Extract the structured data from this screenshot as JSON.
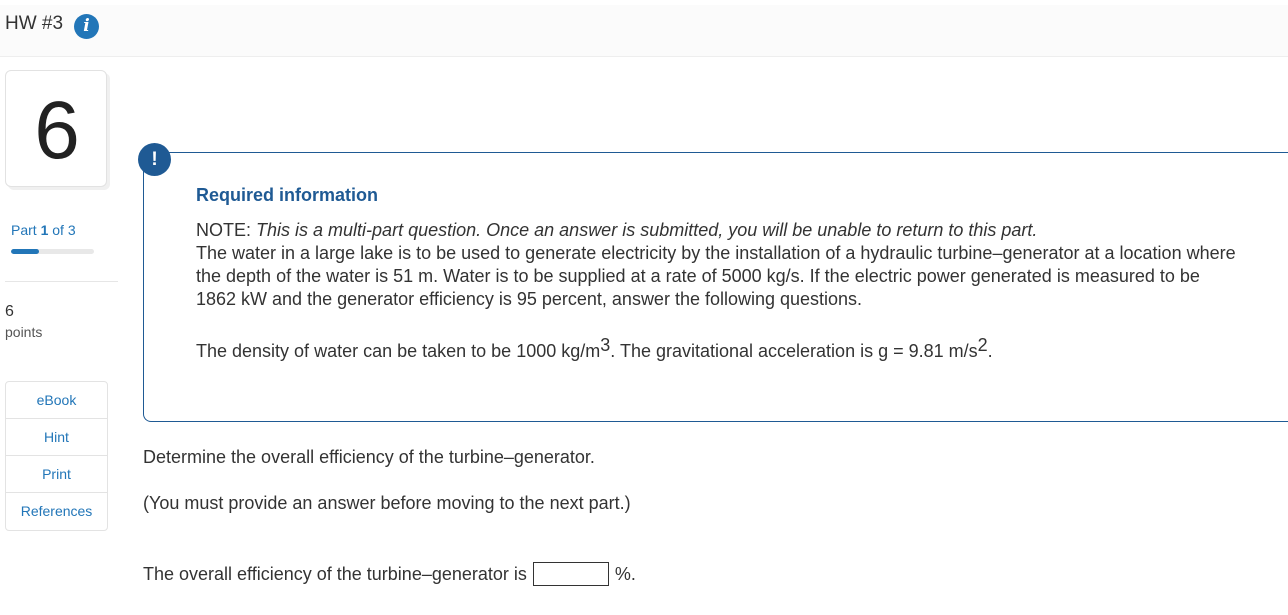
{
  "header": {
    "title": "HW #3",
    "info_icon": "info-icon"
  },
  "question_card": {
    "number": "6"
  },
  "part": {
    "prefix": "Part",
    "current": "1",
    "separator": "of",
    "total": "3",
    "progress_fraction": 0.333
  },
  "points": {
    "value": "6",
    "label": "points"
  },
  "tools": [
    {
      "label": "eBook"
    },
    {
      "label": "Hint"
    },
    {
      "label": "Print"
    },
    {
      "label": "References"
    }
  ],
  "required_info": {
    "alert_symbol": "!",
    "title": "Required information",
    "note_label": "NOTE:",
    "note_text": "This is a multi-part question. Once an answer is submitted, you will be unable to return to this part.",
    "body": "The water in a large lake is to be used to generate electricity by the installation of a hydraulic turbine–generator at a location where the depth of the water is 51 m. Water is to be supplied at a rate of 5000 kg/s. If the electric power generated is measured to be 1862 kW and the generator efficiency is 95 percent, answer the following questions.",
    "density_text": "The density of water can be taken to be 1000 kg/m",
    "density_exp": "3",
    "gravity_text": ". The gravitational acceleration is g = 9.81 m/s",
    "gravity_exp": "2",
    "end_period": "."
  },
  "question": {
    "prompt": "Determine the overall efficiency of the turbine–generator.",
    "instruction": "(You must provide an answer before moving to the next part.)",
    "answer_label": "The overall efficiency of the turbine–generator is",
    "answer_value": "",
    "answer_unit": "%."
  },
  "colors": {
    "accent": "#2276b8",
    "alert": "#1f5a94"
  }
}
